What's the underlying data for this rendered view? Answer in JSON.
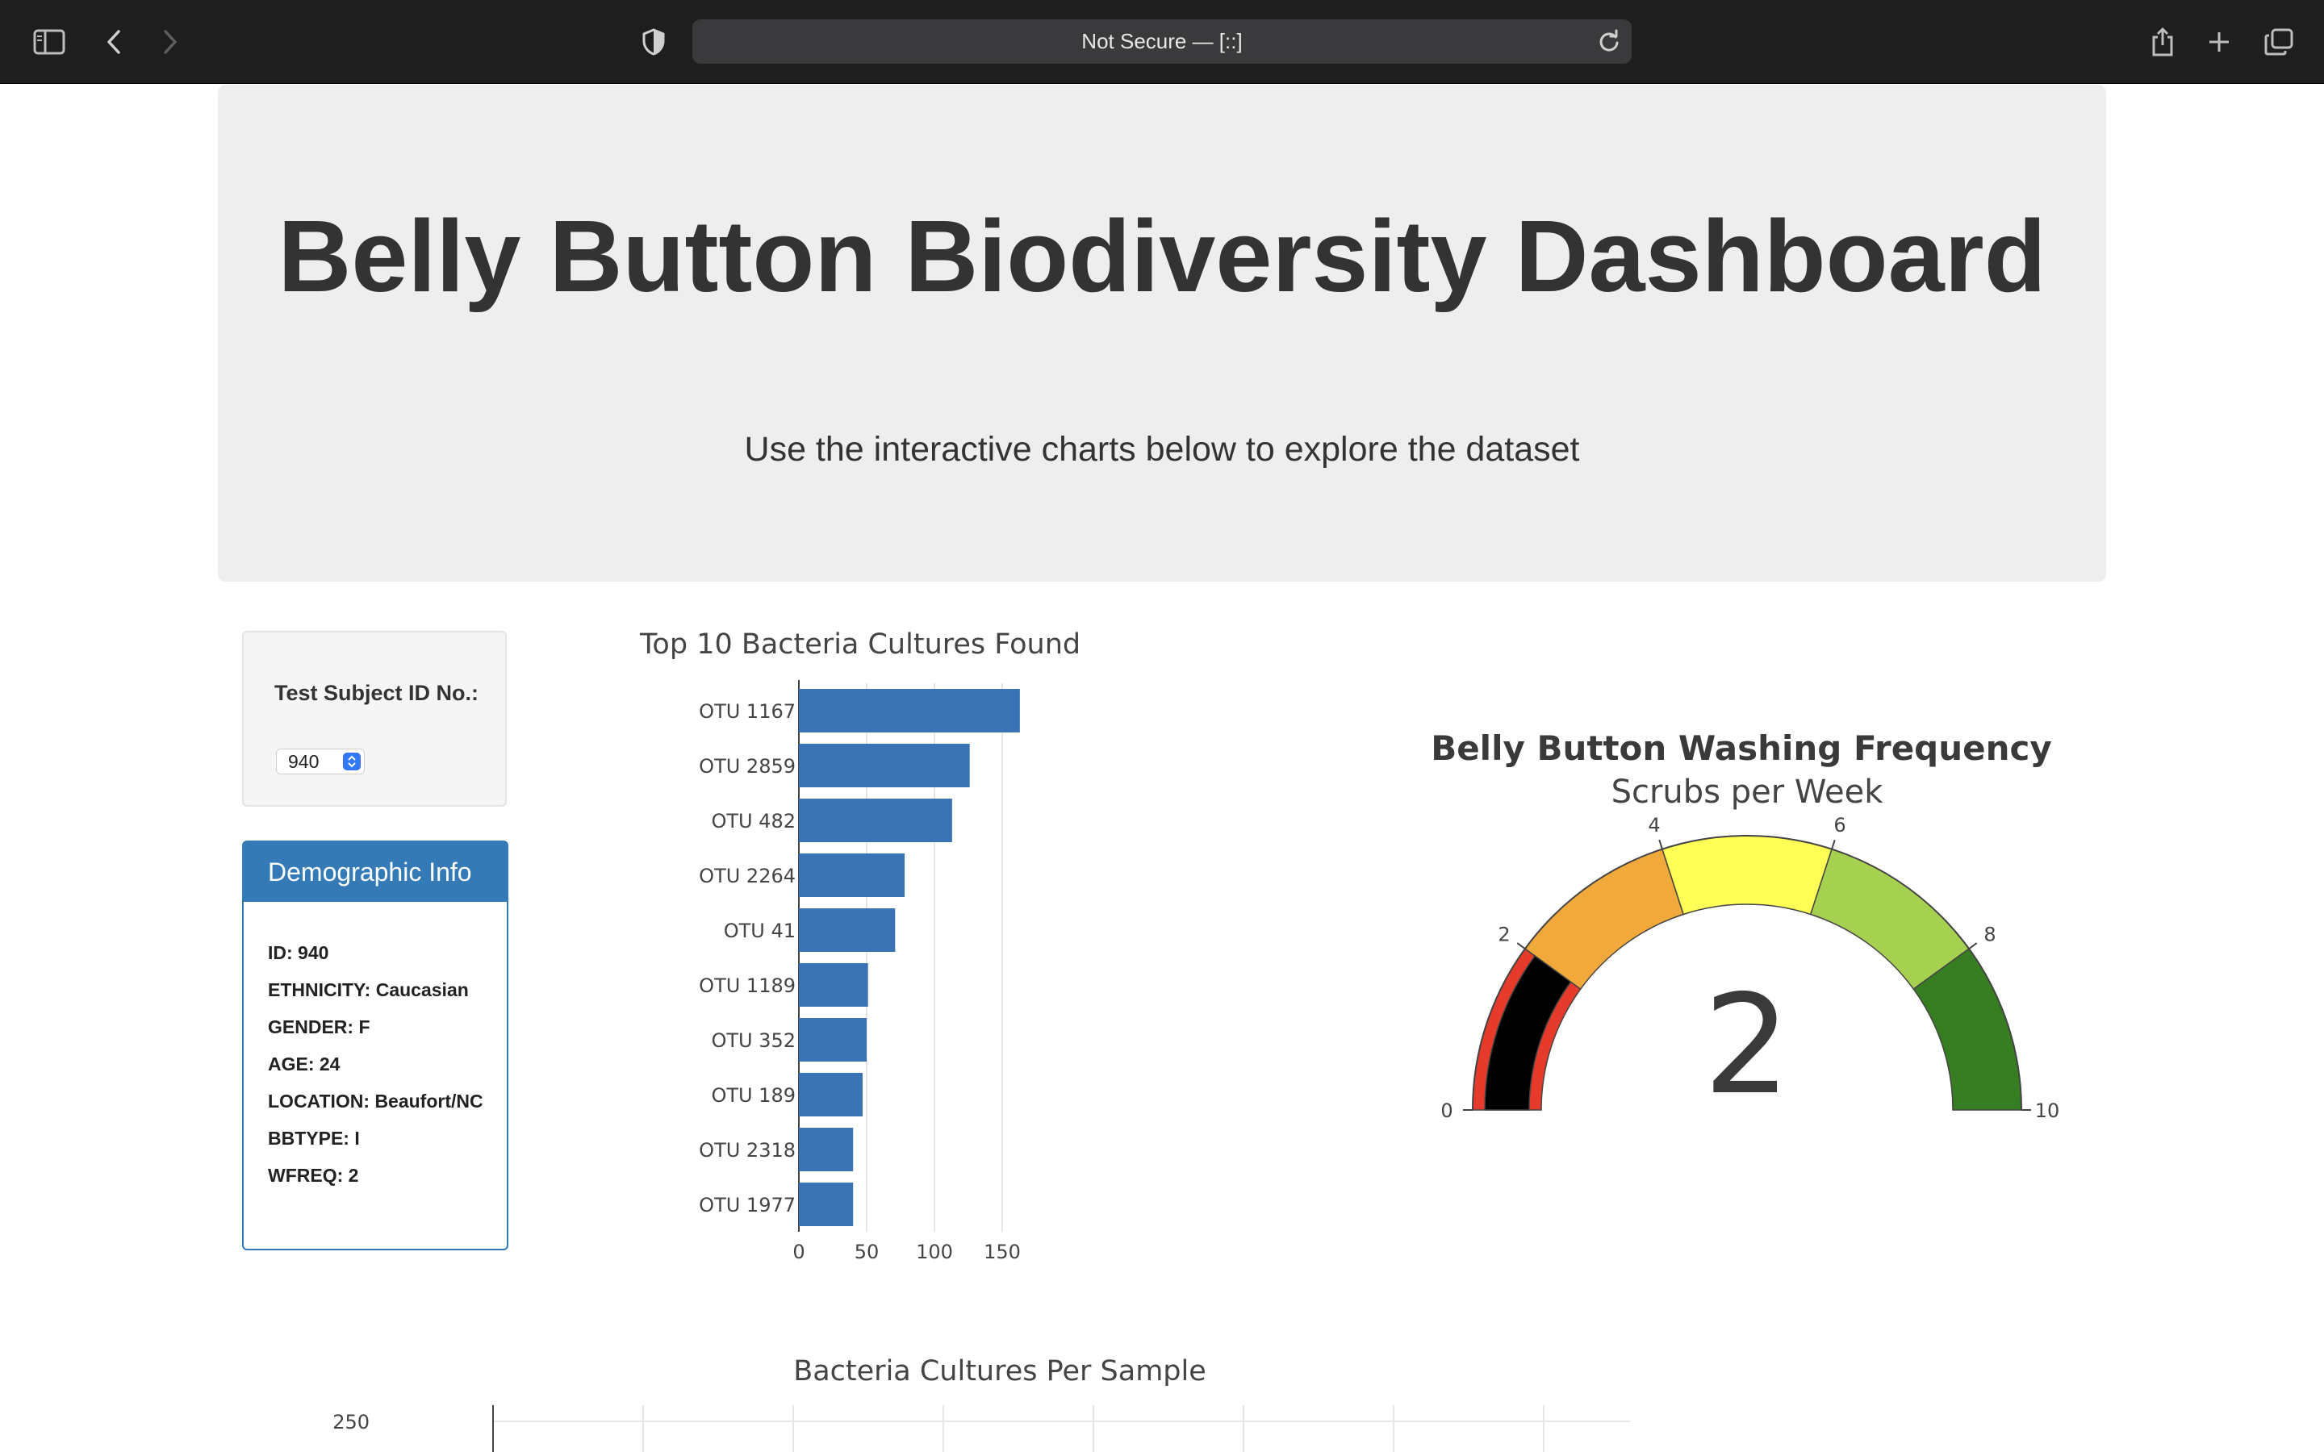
{
  "browser": {
    "url_text": "Not Secure — [::]",
    "icons": [
      "sidebar-icon",
      "back-icon",
      "forward-icon",
      "shield-icon",
      "reload-icon",
      "share-icon",
      "new-tab-icon",
      "tabs-overview-icon"
    ]
  },
  "header": {
    "title": "Belly Button Biodiversity Dashboard",
    "subtitle": "Use the interactive charts below to explore the dataset"
  },
  "selector": {
    "label": "Test Subject ID No.:",
    "selected": "940"
  },
  "demographics": {
    "heading": "Demographic Info",
    "rows": [
      "ID: 940",
      "ETHNICITY: Caucasian",
      "GENDER: F",
      "AGE: 24",
      "LOCATION: Beaufort/NC",
      "BBTYPE: I",
      "WFREQ: 2"
    ]
  },
  "chart_data": [
    {
      "type": "bar",
      "orientation": "horizontal",
      "title": "Top 10 Bacteria Cultures Found",
      "categories": [
        "OTU 1167",
        "OTU 2859",
        "OTU 482",
        "OTU 2264",
        "OTU 41",
        "OTU 1189",
        "OTU 352",
        "OTU 189",
        "OTU 2318",
        "OTU 1977"
      ],
      "values": [
        163,
        126,
        113,
        78,
        71,
        51,
        50,
        47,
        40,
        40
      ],
      "xticks": [
        0,
        50,
        100,
        150
      ],
      "xlim": [
        0,
        163
      ],
      "grid": true,
      "color": "#3a73b3"
    },
    {
      "type": "gauge",
      "title": "Belly Button Washing Frequency",
      "subtitle": "Scrubs per Week",
      "value": 2,
      "range": [
        0,
        10
      ],
      "ticks": [
        0,
        2,
        4,
        6,
        8,
        10
      ],
      "steps": [
        {
          "range": [
            0,
            2
          ],
          "color": "#e63a2a"
        },
        {
          "range": [
            2,
            4
          ],
          "color": "#f2a93b"
        },
        {
          "range": [
            4,
            6
          ],
          "color": "#ffff55"
        },
        {
          "range": [
            6,
            8
          ],
          "color": "#a6d04f"
        },
        {
          "range": [
            8,
            10
          ],
          "color": "#377d22"
        }
      ],
      "bar_color": "#000000"
    },
    {
      "type": "scatter",
      "title": "Bacteria Cultures Per Sample",
      "yticks": [
        250
      ]
    }
  ]
}
